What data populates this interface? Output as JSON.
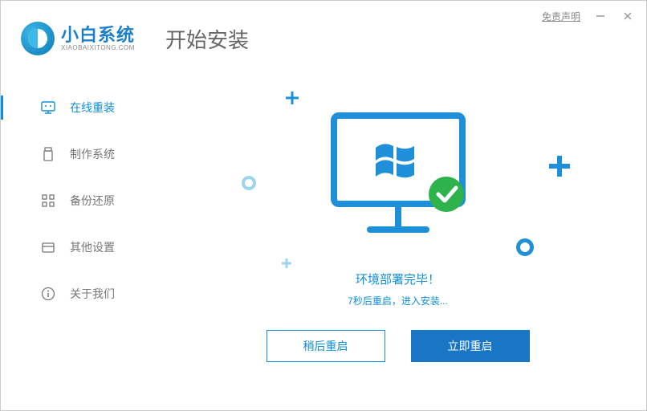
{
  "window": {
    "disclaimer": "免责声明"
  },
  "brand": {
    "title": "小白系统",
    "sub": "XIAOBAIXITONG.COM"
  },
  "page": {
    "title": "开始安装"
  },
  "sidebar": {
    "items": [
      {
        "label": "在线重装",
        "icon": "monitor-icon",
        "active": true
      },
      {
        "label": "制作系统",
        "icon": "usb-icon",
        "active": false
      },
      {
        "label": "备份还原",
        "icon": "grid-icon",
        "active": false
      },
      {
        "label": "其他设置",
        "icon": "box-icon",
        "active": false
      },
      {
        "label": "关于我们",
        "icon": "info-icon",
        "active": false
      }
    ]
  },
  "status": {
    "line1": "环境部署完毕！",
    "line2": "7秒后重启，进入安装..."
  },
  "buttons": {
    "later": "稍后重启",
    "now": "立即重启"
  },
  "colors": {
    "primary": "#0e8fd8",
    "solidBtn": "#1976c5",
    "text": "#666"
  }
}
